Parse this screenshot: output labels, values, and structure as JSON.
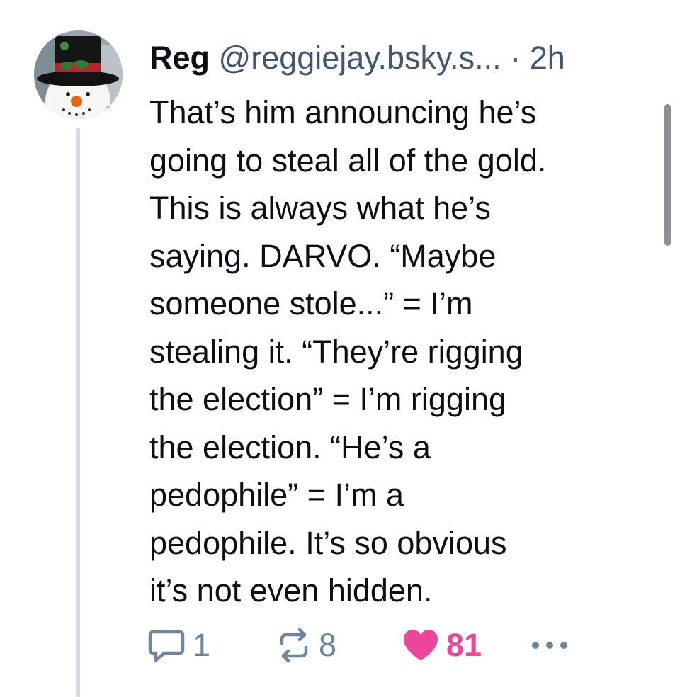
{
  "post": {
    "author_name": "Reg",
    "handle": "@reggiejay.bsky.s...",
    "separator": "·",
    "time_ago": "2h",
    "text": "That’s him announcing he’s\ngoing to steal all of the gold.\nThis is always what he’s\nsaying.  DARVO.  “Maybe\nsomeone stole...” = I’m\nstealing it.  “They’re rigging\nthe election” = I’m rigging\nthe election.  “He’s a\npedophile” = I’m a\npedophile.  It’s so obvious\nit’s not even hidden.",
    "avatar_icon": "snowman-avatar"
  },
  "actions": {
    "reply_count": "1",
    "repost_count": "8",
    "like_count": "81",
    "reply_icon": "reply-icon",
    "repost_icon": "repost-icon",
    "like_icon": "heart-icon",
    "more_icon": "more-icon"
  },
  "colors": {
    "text": "#0b0f14",
    "muted": "#42576c",
    "icon": "#6f869f",
    "like": "#ec4899",
    "thread_line": "#d5dde3"
  }
}
